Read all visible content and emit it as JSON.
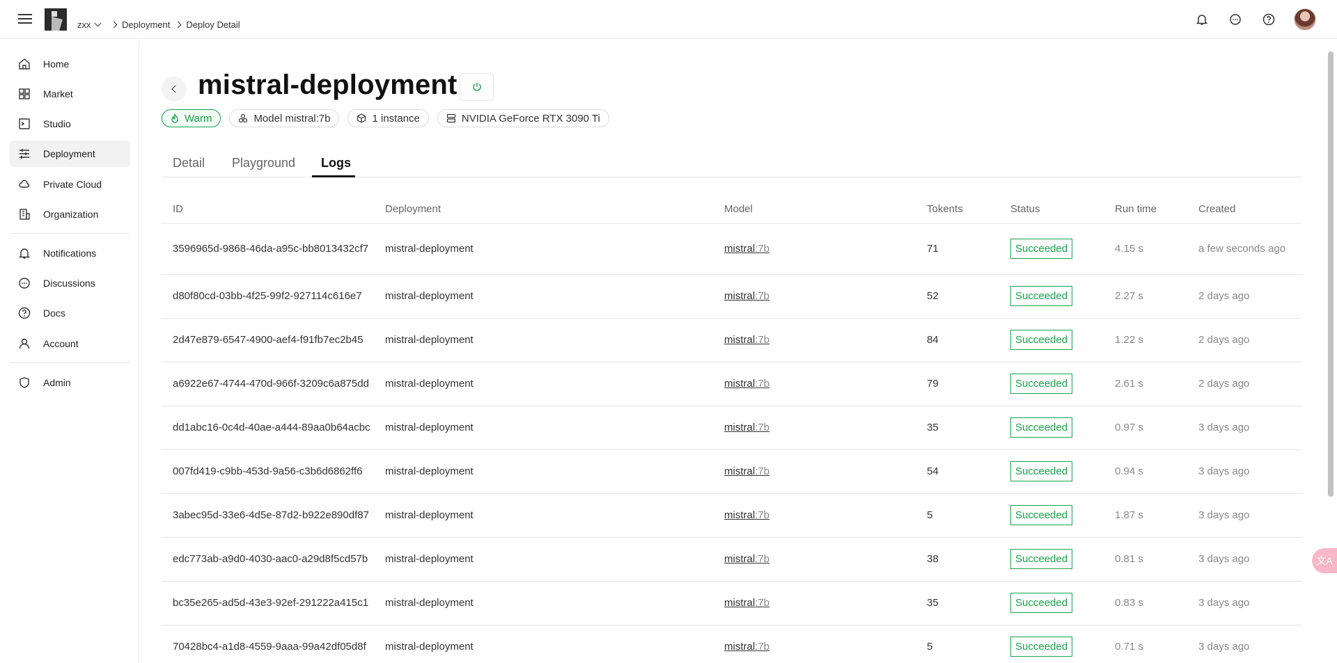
{
  "header": {
    "org": "zxx",
    "breadcrumb": [
      "Deployment",
      "Deploy Detail"
    ],
    "icons": [
      "bell-icon",
      "chat-icon",
      "help-icon"
    ]
  },
  "sidebar": {
    "items": [
      {
        "label": "Home",
        "icon": "home-icon"
      },
      {
        "label": "Market",
        "icon": "grid-icon"
      },
      {
        "label": "Studio",
        "icon": "terminal-icon"
      },
      {
        "label": "Deployment",
        "icon": "sliders-icon"
      },
      {
        "label": "Private Cloud",
        "icon": "cloud-icon"
      },
      {
        "label": "Organization",
        "icon": "building-icon"
      },
      {
        "label": "Notifications",
        "icon": "bell-icon"
      },
      {
        "label": "Discussions",
        "icon": "chat-icon"
      },
      {
        "label": "Docs",
        "icon": "help-icon"
      },
      {
        "label": "Account",
        "icon": "user-icon"
      },
      {
        "label": "Admin",
        "icon": "shield-icon"
      }
    ]
  },
  "page": {
    "title": "mistral-deployment",
    "tags": [
      "Warm",
      "Model mistral:7b",
      "1 instance",
      "NVIDIA GeForce RTX 3090 Ti"
    ],
    "tabs": [
      "Detail",
      "Playground",
      "Logs"
    ],
    "active_tab": "Logs"
  },
  "table": {
    "columns": [
      "ID",
      "Deployment",
      "Model",
      "Tokents",
      "Status",
      "Run time",
      "Created"
    ],
    "rows": [
      {
        "id": "3596965d-9868-46da-a95c-bb8013432cf7",
        "deployment": "mistral-deployment",
        "model": "mistral",
        "version": ":7b",
        "tokens": "71",
        "status": "Succeeded",
        "runtime": "4.15 s",
        "created": "a few seconds ago"
      },
      {
        "id": "d80f80cd-03bb-4f25-99f2-927114c616e7",
        "deployment": "mistral-deployment",
        "model": "mistral",
        "version": ":7b",
        "tokens": "52",
        "status": "Succeeded",
        "runtime": "2.27 s",
        "created": "2 days ago"
      },
      {
        "id": "2d47e879-6547-4900-aef4-f91fb7ec2b45",
        "deployment": "mistral-deployment",
        "model": "mistral",
        "version": ":7b",
        "tokens": "84",
        "status": "Succeeded",
        "runtime": "1.22 s",
        "created": "2 days ago"
      },
      {
        "id": "a6922e67-4744-470d-966f-3209c6a875dd",
        "deployment": "mistral-deployment",
        "model": "mistral",
        "version": ":7b",
        "tokens": "79",
        "status": "Succeeded",
        "runtime": "2.61 s",
        "created": "2 days ago"
      },
      {
        "id": "dd1abc16-0c4d-40ae-a444-89aa0b64acbc",
        "deployment": "mistral-deployment",
        "model": "mistral",
        "version": ":7b",
        "tokens": "35",
        "status": "Succeeded",
        "runtime": "0.97 s",
        "created": "3 days ago"
      },
      {
        "id": "007fd419-c9bb-453d-9a56-c3b6d6862ff6",
        "deployment": "mistral-deployment",
        "model": "mistral",
        "version": ":7b",
        "tokens": "54",
        "status": "Succeeded",
        "runtime": "0.94 s",
        "created": "3 days ago"
      },
      {
        "id": "3abec95d-33e6-4d5e-87d2-b922e890df87",
        "deployment": "mistral-deployment",
        "model": "mistral",
        "version": ":7b",
        "tokens": "5",
        "status": "Succeeded",
        "runtime": "1.87 s",
        "created": "3 days ago"
      },
      {
        "id": "edc773ab-a9d0-4030-aac0-a29d8f5cd57b",
        "deployment": "mistral-deployment",
        "model": "mistral",
        "version": ":7b",
        "tokens": "38",
        "status": "Succeeded",
        "runtime": "0.81 s",
        "created": "3 days ago"
      },
      {
        "id": "bc35e265-ad5d-43e3-92ef-291222a415c1",
        "deployment": "mistral-deployment",
        "model": "mistral",
        "version": ":7b",
        "tokens": "35",
        "status": "Succeeded",
        "runtime": "0.83 s",
        "created": "3 days ago"
      },
      {
        "id": "70428bc4-a1d8-4559-9aaa-99a42df05d8f",
        "deployment": "mistral-deployment",
        "model": "mistral",
        "version": ":7b",
        "tokens": "5",
        "status": "Succeeded",
        "runtime": "0.71 s",
        "created": "3 days ago"
      }
    ]
  },
  "colors": {
    "accent_green": "#16a34a",
    "border": "#e5e5e5"
  },
  "floating_button": {
    "label": "文A"
  }
}
